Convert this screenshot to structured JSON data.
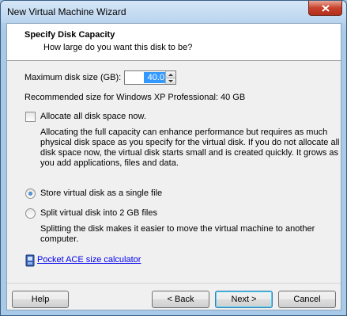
{
  "window": {
    "title": "New Virtual Machine Wizard"
  },
  "header": {
    "title": "Specify Disk Capacity",
    "subtitle": "How large do you want this disk to be?"
  },
  "disk_size": {
    "label": "Maximum disk size (GB):",
    "value": "40.0",
    "recommended": "Recommended size for Windows XP Professional: 40 GB"
  },
  "allocate": {
    "label": "Allocate all disk space now.",
    "checked": false,
    "description_lines": [
      "Allocating the full capacity can enhance performance but requires as much",
      "physical disk space as you specify for the virtual disk. If you do not allocate all",
      "disk space now, the virtual disk starts small and is created quickly. It grows as",
      "you add applications, files and data."
    ]
  },
  "storage_options": {
    "single_label": "Store virtual disk as a single file",
    "split_label": "Split virtual disk into 2 GB files",
    "selected": "single",
    "split_description_lines": [
      "Splitting the disk makes it easier to move the virtual machine to another",
      "computer."
    ]
  },
  "calculator_link": {
    "label": "Pocket ACE size calculator",
    "icon": "device-icon"
  },
  "buttons": {
    "help": "Help",
    "back": "< Back",
    "next": "Next >",
    "cancel": "Cancel"
  },
  "colors": {
    "selection": "#3399ff",
    "link": "#0000ee",
    "titlebar": "#b9d3ee",
    "close": "#c7412c"
  }
}
